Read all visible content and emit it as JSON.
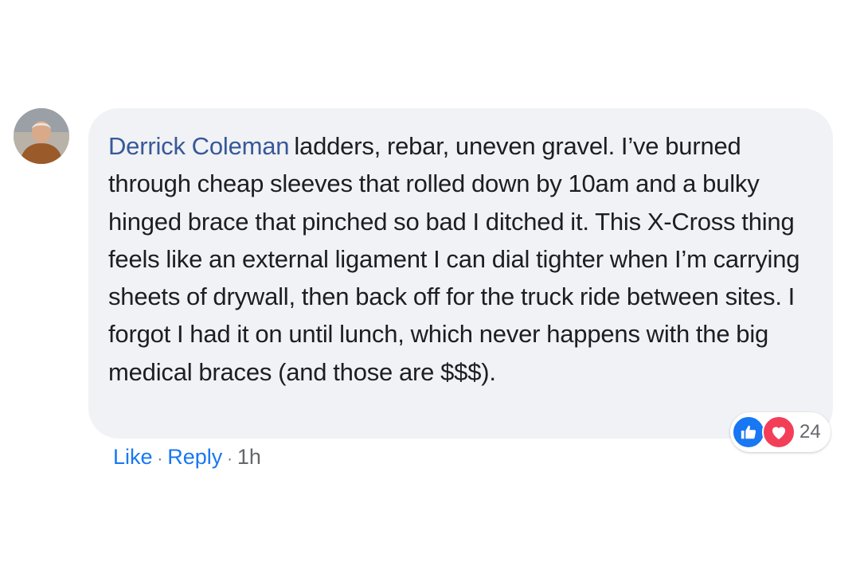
{
  "comment": {
    "author": "Derrick Coleman",
    "text": "ladders, rebar, uneven gravel. I’ve burned through cheap sleeves that rolled down by 10am and a bulky hinged brace that pinched so bad I ditched it. This X-Cross thing feels like an external ligament I can dial tighter when I’m carrying sheets of drywall, then back off for the truck ride between sites. I forgot I had it on until lunch, which never happens with the big medical braces (and those are $$$).",
    "reactions": {
      "icons": [
        "like-icon",
        "love-icon"
      ],
      "count": "24"
    },
    "actions": {
      "like_label": "Like",
      "reply_label": "Reply",
      "separator": "·",
      "time": "1h"
    }
  },
  "colors": {
    "author": "#385898",
    "link": "#1877f2",
    "bubble": "#f0f2f5",
    "muted": "#65676b",
    "like": "#1877f2",
    "love": "#f33e58"
  }
}
